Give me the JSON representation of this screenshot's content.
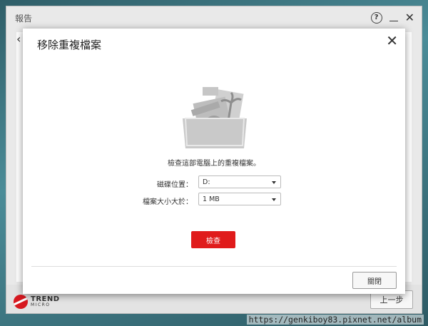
{
  "app": {
    "title": "報告",
    "help_glyph": "?",
    "back_glyph": "‹",
    "close_glyph": "✕",
    "prev_button_label": "上一步",
    "logo": {
      "line1": "TREND",
      "line2": "MICRO"
    }
  },
  "modal": {
    "title": "移除重複檔案",
    "close_glyph": "✕",
    "description": "檢查這部電腦上的重複檔案。",
    "fields": [
      {
        "label": "磁碟位置：",
        "value": "D:"
      },
      {
        "label": "檔案大小大於：",
        "value": "1 MB"
      }
    ],
    "check_button_label": "檢查",
    "close_button_label": "關閉"
  },
  "watermark": "https://genkiboy83.pixnet.net/album",
  "colors": {
    "accent_red": "#e01b1b",
    "logo_red": "#d71920"
  },
  "icons": {
    "illustration": "duplicate-files-folder-icon"
  }
}
